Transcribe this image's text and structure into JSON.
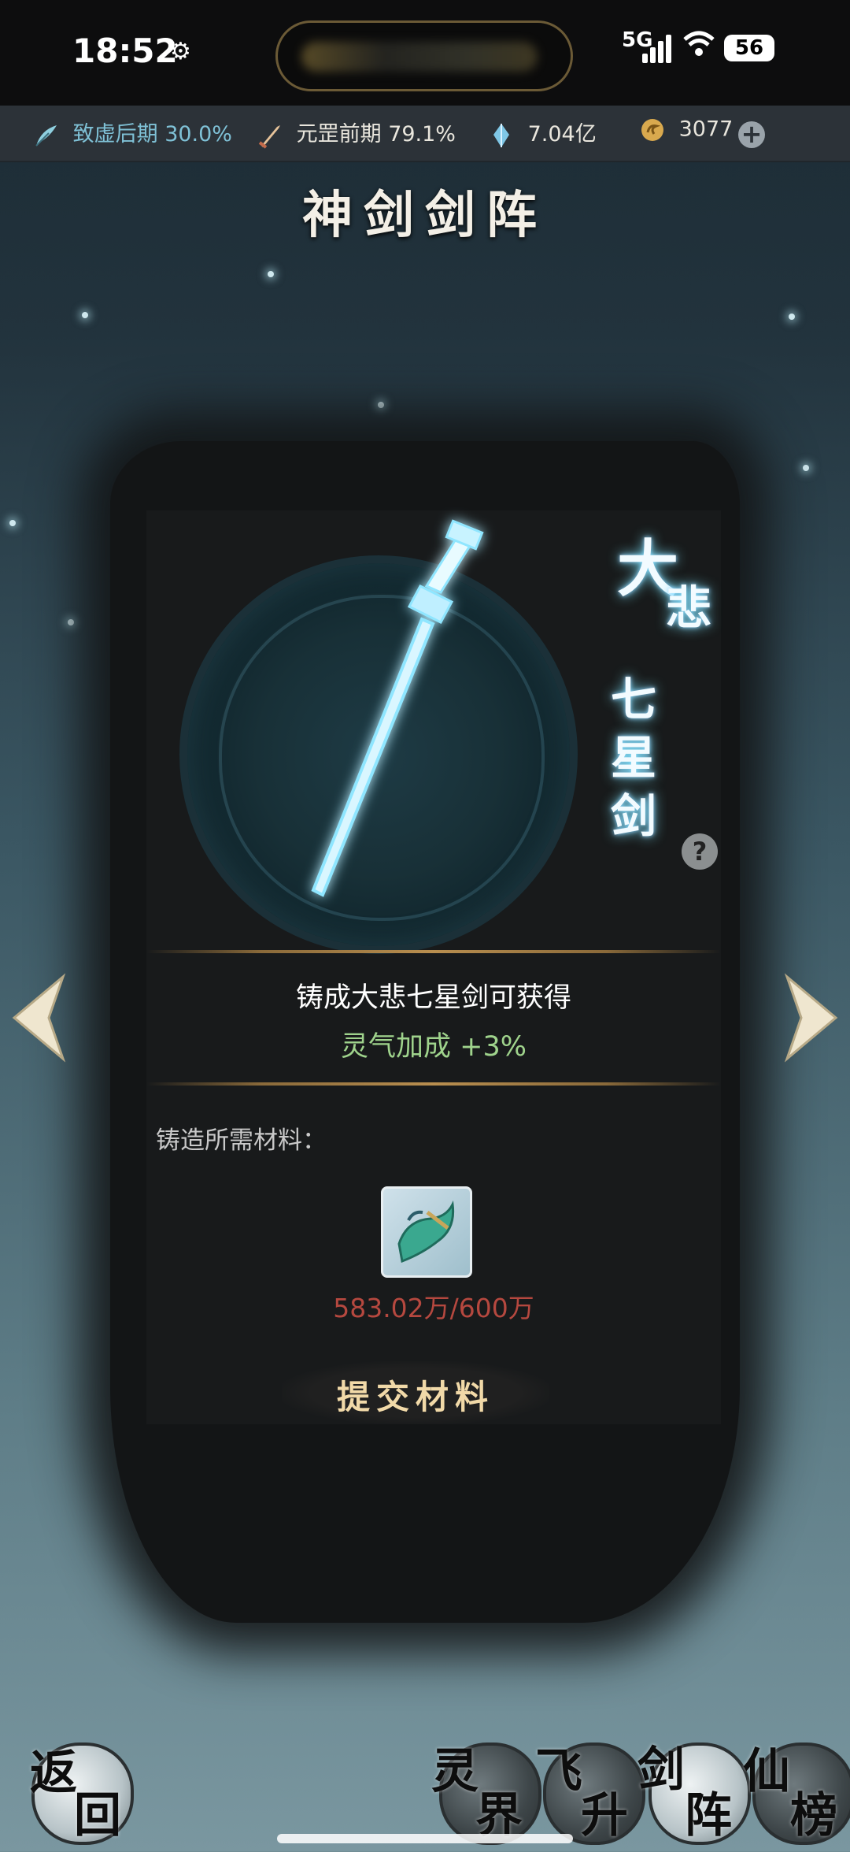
{
  "status_bar": {
    "time": "18:52",
    "signal": "5G",
    "battery": "56"
  },
  "resources": [
    {
      "icon": "feather-icon",
      "label": "致虚后期",
      "value": "30.0%"
    },
    {
      "icon": "sword-icon",
      "label": "元罡前期",
      "value": "79.1%"
    },
    {
      "icon": "crystal-icon",
      "label": "",
      "value": "7.04亿"
    },
    {
      "icon": "coin-icon",
      "label": "",
      "value": "3077"
    }
  ],
  "page": {
    "title": "神剑剑阵"
  },
  "sword": {
    "name_big": "大",
    "name_chars": [
      "悲",
      "七",
      "星",
      "剑"
    ],
    "help": "?"
  },
  "reward": {
    "title": "铸成大悲七星剑可获得",
    "bonus": "灵气加成 +3%"
  },
  "materials": {
    "label": "铸造所需材料：",
    "count": "583.02万/600万"
  },
  "submit_label": "提交材料",
  "nav": {
    "back": [
      "返",
      "回"
    ],
    "spirit_realm": [
      "灵",
      "界"
    ],
    "ascend": [
      "飞",
      "升"
    ],
    "sword_array": [
      "剑",
      "阵"
    ],
    "immortal_rank": [
      "仙",
      "榜"
    ]
  },
  "colors": {
    "accent_gold": "#f1d9a8",
    "bonus_green": "#9fd38c",
    "count_red": "#b5483f",
    "resource_blue": "#7fc1d6"
  }
}
